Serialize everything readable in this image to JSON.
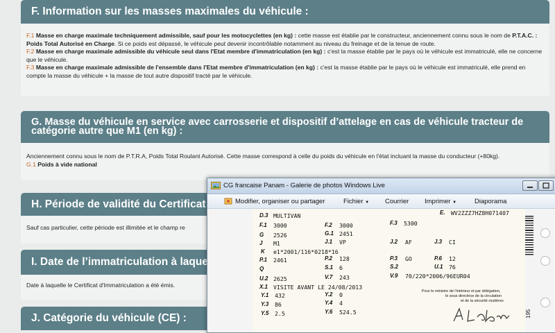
{
  "sections": {
    "f": {
      "title": "F. Information sur les masses maximales du véhicule :",
      "p1_code": "F.1",
      "p1_bold": "Masse en charge maximale techniquement admissible, sauf pour les motocyclettes (en kg) :",
      "p1_text": "cette masse est établie par le constructeur, anciennement connu sous le nom de",
      "p1_bold2": "P.T.A.C. : Poids Total Autorisé en Charge",
      "p1_text2": ". Si ce poids est dépassé, le véhicule peut devenir incontrôlable notamment au niveau du freinage et de la tenue de route.",
      "p2_code": "F.2",
      "p2_bold": "Masse en charge maximale admissible du véhicule seul dans l'Etat membre d'immatriculation (en kg) :",
      "p2_text": "c'est la masse établie par le pays où le véhicule est immatriculé, elle ne concerne que le véhicule.",
      "p3_code": "F.3",
      "p3_bold": "Masse en charge maximale admissible de l'ensemble dans l'Etat membre d'immatriculation (en kg) :",
      "p3_text": "c'est la masse établie par le pays où le véhicule est immatriculé, elle prend en compte la masse du véhicule + la masse de tout autre dispositif tracté par le véhicule."
    },
    "g": {
      "title": "G. Masse du véhicule en service avec carrosserie et dispositif d’attelage en cas de véhicule tracteur de catégorie autre que M1 (en kg) :",
      "text": "Anciennement connu sous le nom de P.T.R.A, Poids Total Roulant Autorisé. Cette masse correspond à celle du poids du véhicule en l'état incluant la masse du conducteur (+80kg).",
      "sub_code": "G.1",
      "sub_bold": "Poids à vide national"
    },
    "h": {
      "title": "H. Période de validité du Certificat",
      "text": "Sauf cas particulier, cette période est illimitée et le champ re"
    },
    "i": {
      "title": "I. Date de l’immatriculation à laque",
      "text": "Date à laquelle le Certificat d'Immatriculation a été émis."
    },
    "j": {
      "title": "J. Catégorie du véhicule (CE) :"
    }
  },
  "window": {
    "title": "CG francaise Panam - Galerie de photos Windows Live",
    "menu": {
      "edit": "Modifier, organiser ou partager",
      "file": "Fichier",
      "email": "Courrier",
      "print": "Imprimer",
      "slideshow": "Diaporama"
    },
    "card": {
      "d3_label": "D.3",
      "d3": "MULTIVAN",
      "e_label": "E.",
      "e": "WV2ZZZ7HZ8H071407",
      "f1_label": "F.1",
      "f1": "3000",
      "f2_label": "F.2",
      "f2": "3000",
      "f3_label": "F.3",
      "f3": "5300",
      "g_label": "G",
      "g": "2526",
      "g1_label": "G.1",
      "g1": "2451",
      "j_label": "J",
      "j": "M1",
      "j1_label": "J.1",
      "j1": "VP",
      "j2_label": "J.2",
      "j2": "AF",
      "j3_label": "J.3",
      "j3": "CI",
      "k_label": "K",
      "k": "e1*2001/116*0218*16",
      "p1_label": "P.1",
      "p1": "2461",
      "p2_label": "P.2",
      "p2": "128",
      "p3_label": "P.3",
      "p3": "GO",
      "p6_label": "P.6",
      "p6": "12",
      "q_label": "Q",
      "s1_label": "S.1",
      "s1": "6",
      "s2_label": "S.2",
      "u1_label": "U.1",
      "u1": "76",
      "u2_label": "U.2",
      "u2": "2625",
      "v7_label": "V.7",
      "v7": "243",
      "v9_label": "V.9",
      "v9": "70/220*2006/96EUR04",
      "x1_label": "X.1",
      "x1": "VISITE AVANT LE 24/08/2013",
      "y1_label": "Y.1",
      "y1": "432",
      "y2_label": "Y.2",
      "y2": "0",
      "y3_label": "Y.3",
      "y3": "86",
      "y4_label": "Y.4",
      "y4": "4",
      "y5_label": "Y.5",
      "y5": "2.5",
      "y6_label": "Y.6",
      "y6": "524.5",
      "prefet1": "Pour le ministre de l'intérieur et par délégation,",
      "prefet2": "le sous directrice de la circulation",
      "prefet3": "et de la sécurité routières",
      "side_number": "195"
    }
  }
}
